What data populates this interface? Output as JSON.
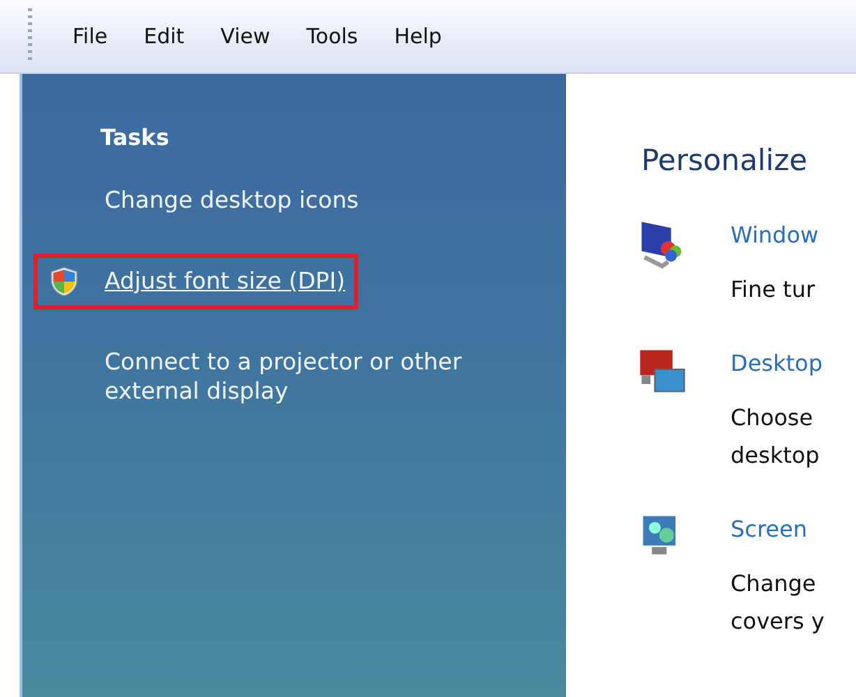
{
  "menu": [
    "File",
    "Edit",
    "View",
    "Tools",
    "Help"
  ],
  "tasks": {
    "title": "Tasks",
    "items": [
      {
        "label": "Change desktop icons",
        "kind": "link",
        "highlighted": false
      },
      {
        "label": "Adjust font size (DPI)",
        "kind": "shield-link",
        "highlighted": true
      },
      {
        "label": "Connect to a projector or other external display",
        "kind": "link",
        "highlighted": false
      }
    ]
  },
  "panel": {
    "title": "Personalize",
    "items": [
      {
        "kind": "window-color",
        "title": "Window",
        "description": [
          "Fine tur"
        ]
      },
      {
        "kind": "desktop",
        "title": "Desktop",
        "description": [
          "Choose",
          "desktop"
        ]
      },
      {
        "kind": "screensaver",
        "title": "Screen",
        "description": [
          "Change",
          "covers y"
        ]
      }
    ]
  }
}
